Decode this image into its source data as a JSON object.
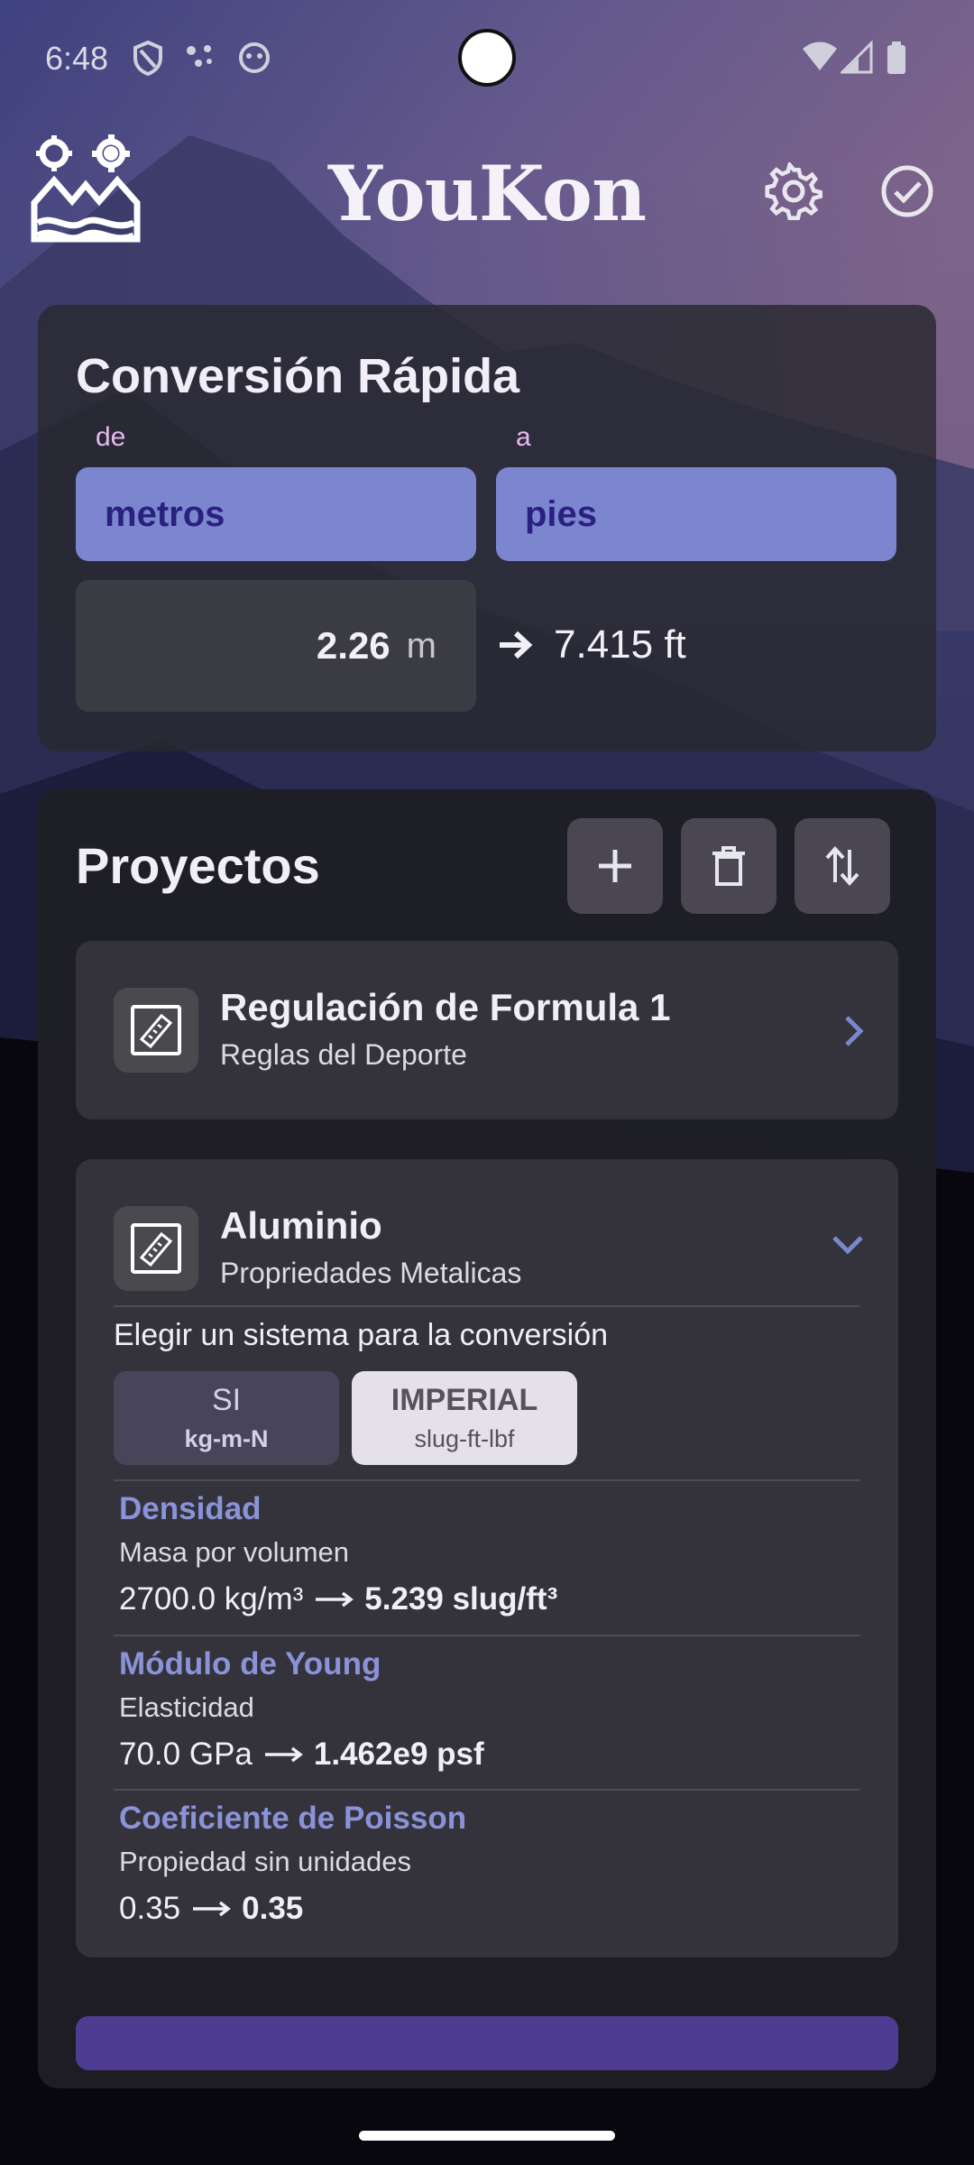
{
  "status_bar": {
    "time": "6:48"
  },
  "header": {
    "app_title": "YouKon"
  },
  "quick_conversion": {
    "title": "Conversión Rápida",
    "from_label": "de",
    "to_label": "a",
    "from_unit": "metros",
    "to_unit": "pies",
    "input_value": "2.26",
    "input_unit": "m",
    "result": "7.415 ft"
  },
  "projects": {
    "title": "Proyectos",
    "items": [
      {
        "name": "Regulación de Formula 1",
        "subtitle": "Reglas del Deporte"
      },
      {
        "name": "Aluminio",
        "subtitle": "Propriedades Metalicas",
        "system_prompt": "Elegir un sistema para la conversión",
        "systems": [
          {
            "name": "SI",
            "units": "kg-m-N"
          },
          {
            "name": "IMPERIAL",
            "units": "slug-ft-lbf"
          }
        ],
        "properties": [
          {
            "name": "Densidad",
            "description": "Masa por volumen",
            "from": "2700.0 kg/m³",
            "to": "5.239 slug/ft³"
          },
          {
            "name": "Módulo de Young",
            "description": "Elasticidad",
            "from": "70.0 GPa",
            "to": "1.462e9 psf"
          },
          {
            "name": "Coeficiente de Poisson",
            "description": "Propiedad sin unidades",
            "from": "0.35",
            "to": "0.35"
          }
        ]
      }
    ]
  },
  "colors": {
    "accent": "#7c86cf",
    "accent_text": "#2a2080",
    "property_title": "#8a93d8",
    "bottom_bar": "#4e3b92"
  }
}
